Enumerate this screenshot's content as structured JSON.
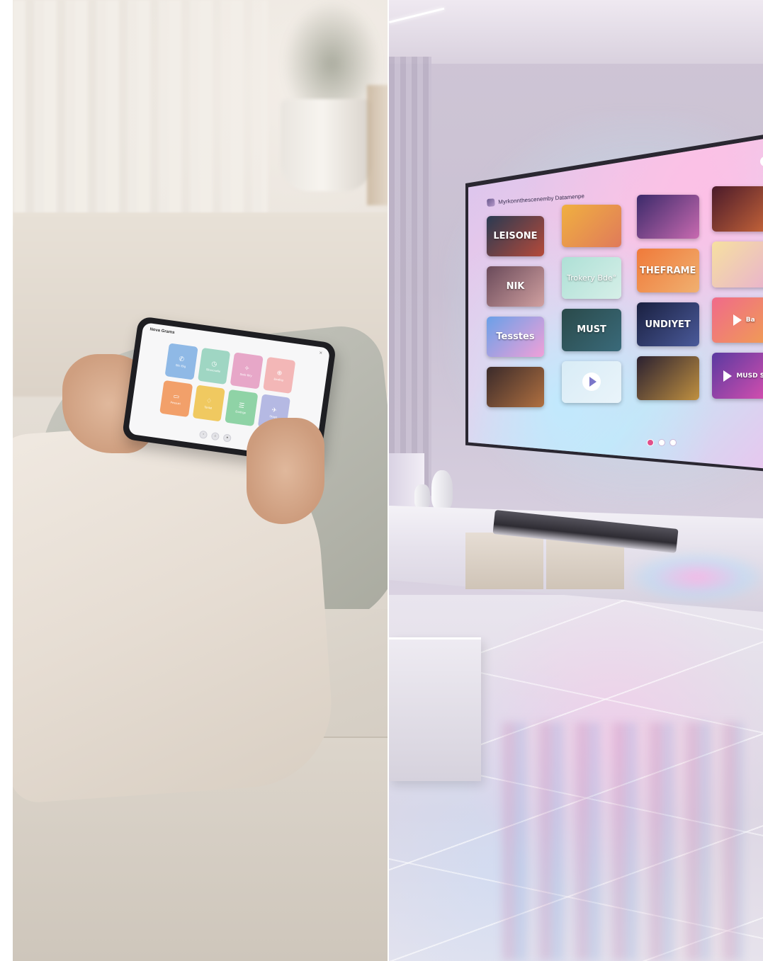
{
  "tablet": {
    "title": "Nova Grams",
    "close_glyph": "✕",
    "tiles": [
      {
        "icon": "✆",
        "label": "Slin Elig",
        "color": "#8fb9e6"
      },
      {
        "icon": "◷",
        "label": "Slovzouelle",
        "color": "#9fd6c3"
      },
      {
        "icon": "✧",
        "label": "Sinfe Biry",
        "color": "#e7a7c8"
      },
      {
        "icon": "⊕",
        "label": "Eiraling",
        "color": "#f3b7b7"
      },
      {
        "icon": "▭",
        "label": "Pessuei",
        "color": "#f2a06a"
      },
      {
        "icon": "♢",
        "label": "Tanlat",
        "color": "#f0c960"
      },
      {
        "icon": "☰",
        "label": "Exrtinge",
        "color": "#8fd3a6"
      },
      {
        "icon": "✈",
        "label": "Skopit",
        "color": "#b5b9e3"
      }
    ],
    "dock": [
      "‹",
      "⌂",
      "●"
    ]
  },
  "tv": {
    "header": "Myrkonnthescenemby Datamenpe",
    "corner_icon": "☐",
    "posters": [
      {
        "text": "LEISONE",
        "color1": "#2a3a52",
        "color2": "#b54a3a"
      },
      {
        "text": "",
        "color1": "#f0b040",
        "color2": "#e07a5a"
      },
      {
        "text": "",
        "color1": "#3b2a6a",
        "color2": "#c86ab0"
      },
      {
        "text": "",
        "color1": "#4a1a2a",
        "color2": "#d06a3a"
      },
      {
        "text": "NIK",
        "color1": "#6a4a5a",
        "color2": "#d0a0a0"
      },
      {
        "text": "Trokery Bde°",
        "color1": "#aee0d6",
        "color2": "#d6efe8"
      },
      {
        "text": "THEFRAME",
        "color1": "#f07a3a",
        "color2": "#f0b070"
      },
      {
        "text": "",
        "color1": "#f6e0a0",
        "color2": "#e8b0d0"
      },
      {
        "text": "Tesstes",
        "color1": "#6aa0e8",
        "color2": "#f0a0d8"
      },
      {
        "text": "MUST",
        "color1": "#2a4a4a",
        "color2": "#3a6a7a"
      },
      {
        "text": "UNDIYET",
        "color1": "#1a2040",
        "color2": "#4a5a9a"
      },
      {
        "text": "Ba",
        "color1": "#f06a8a",
        "color2": "#f0a050"
      },
      {
        "text": "",
        "color1": "#3a2a2a",
        "color2": "#b07040"
      },
      {
        "text": "",
        "color1": "#d8ecf6",
        "color2": "#eaf4fa"
      },
      {
        "text": "",
        "color1": "#2a2030",
        "color2": "#c09040"
      },
      {
        "text": "MUSD S",
        "color1": "#5a3aa0",
        "color2": "#e050b0"
      }
    ],
    "pager": [
      true,
      false,
      false
    ]
  }
}
